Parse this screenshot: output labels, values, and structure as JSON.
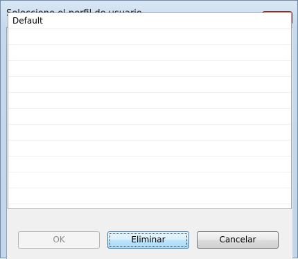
{
  "window": {
    "title": "Seleccione el perfil de usuario",
    "close_icon": "close-icon"
  },
  "profile_list": {
    "items": [
      "Default",
      "",
      "",
      "",
      "",
      "",
      "",
      "",
      "",
      "",
      "",
      ""
    ]
  },
  "buttons": {
    "ok_label": "OK",
    "ok_enabled": false,
    "delete_label": "Eliminar",
    "cancel_label": "Cancelar"
  },
  "colors": {
    "close_button": "#c13d24",
    "title_bar": "#c7d9ec",
    "client_background": "#f0f0f0",
    "default_button_border": "#3c7fb1"
  }
}
